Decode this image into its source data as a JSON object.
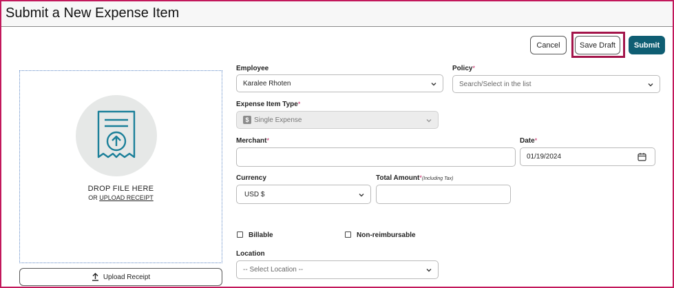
{
  "header": {
    "title": "Submit a New Expense Item"
  },
  "toolbar": {
    "cancel_label": "Cancel",
    "save_draft_label": "Save Draft",
    "submit_label": "Submit"
  },
  "dropzone": {
    "drop_text": "DROP FILE HERE",
    "or_text": "OR",
    "upload_link": "UPLOAD RECEIPT",
    "icon": "receipt-upload-icon"
  },
  "upload_button": {
    "label": "Upload Receipt",
    "icon": "upload-icon"
  },
  "form": {
    "employee": {
      "label": "Employee",
      "value": "Karalee Rhoten"
    },
    "policy": {
      "label": "Policy",
      "required_mark": "*",
      "placeholder": "Search/Select in the list"
    },
    "expense_type": {
      "label": "Expense Item Type",
      "required_mark": "*",
      "value": "Single Expense",
      "badge": "$"
    },
    "merchant": {
      "label": "Merchant",
      "required_mark": "*",
      "value": ""
    },
    "date": {
      "label": "Date",
      "required_mark": "*",
      "value": "01/19/2024",
      "icon": "calendar-icon"
    },
    "currency": {
      "label": "Currency",
      "value": "USD $"
    },
    "total_amount": {
      "label": "Total Amount",
      "required_mark": "*",
      "hint": "(Including Tax)",
      "value": ""
    },
    "billable": {
      "label": "Billable",
      "checked": false
    },
    "non_reimbursable": {
      "label": "Non-reimbursable",
      "checked": false
    },
    "location": {
      "label": "Location",
      "placeholder": "-- Select Location --"
    }
  },
  "colors": {
    "accent": "#0f5e73",
    "highlight": "#a3154a",
    "frame": "#c2185b",
    "required": "#c2185b"
  }
}
